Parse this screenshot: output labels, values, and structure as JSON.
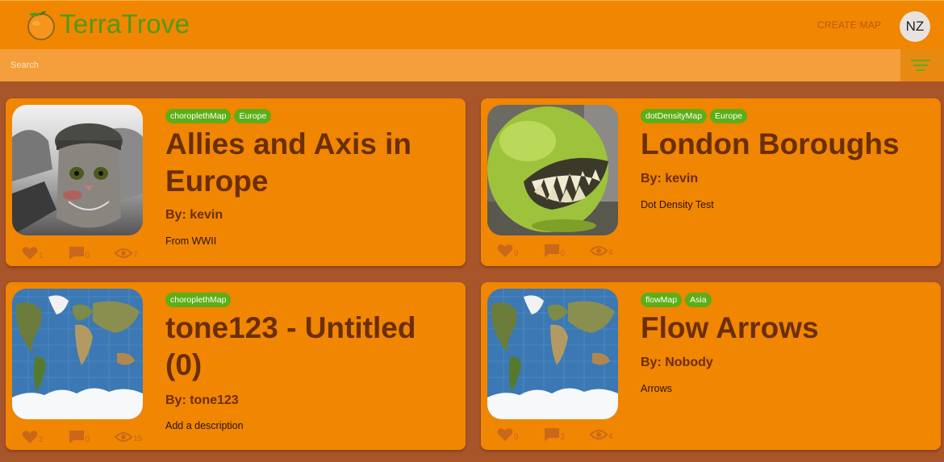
{
  "header": {
    "brand": "TerraTrove",
    "create_map": "CREATE MAP",
    "avatar_initials": "NZ"
  },
  "search": {
    "placeholder": "Search"
  },
  "colors": {
    "header_bg": "#f08602",
    "page_bg": "#a8552a",
    "card_bg": "#f08602",
    "tag_bg": "#5dae17",
    "title_text": "#6b2e05",
    "brand_text": "#4f9a17"
  },
  "cards": [
    {
      "tags": [
        "choroplethMap",
        "Europe"
      ],
      "title": "Allies and Axis in Europe",
      "author": "By: kevin",
      "description": "From WWII",
      "likes": "1",
      "comments": "0",
      "views": "7",
      "thumbnail": "cat-soldier-photo"
    },
    {
      "tags": [
        "dotDensityMap",
        "Europe"
      ],
      "title": "London Boroughs",
      "author": "By: kevin",
      "description": "Dot Density Test",
      "likes": "0",
      "comments": "0",
      "views": "4",
      "thumbnail": "lime-teeth-photo"
    },
    {
      "tags": [
        "choroplethMap"
      ],
      "title": "tone123 - Untitled (0)",
      "author": "By: tone123",
      "description": "Add a description",
      "likes": "2",
      "comments": "0",
      "views": "15",
      "thumbnail": "world-map"
    },
    {
      "tags": [
        "flowMap",
        "Asia"
      ],
      "title": "Flow Arrows",
      "author": "By: Nobody",
      "description": "Arrows",
      "likes": "0",
      "comments": "2",
      "views": "4",
      "thumbnail": "world-map"
    }
  ]
}
